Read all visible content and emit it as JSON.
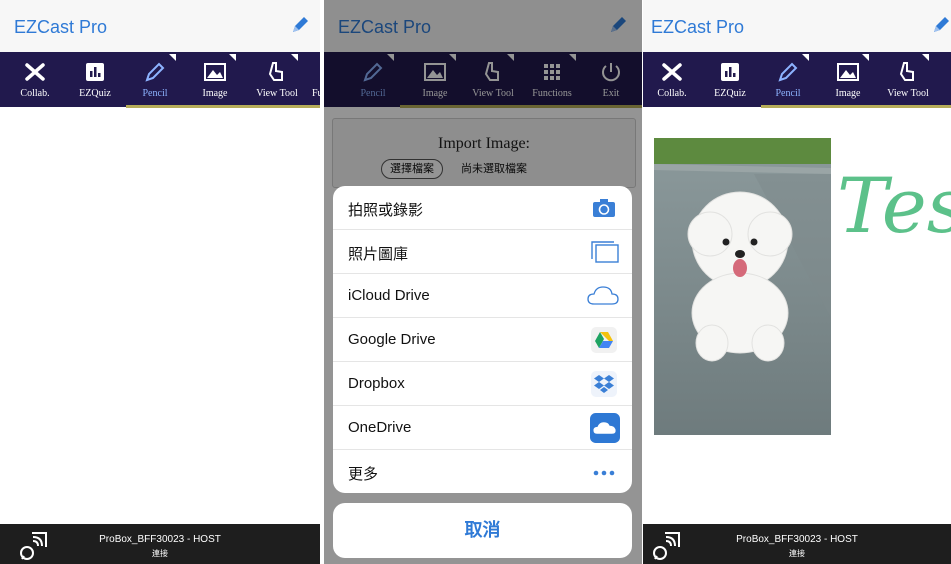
{
  "app_title": "EZCast Pro",
  "panel1": {
    "tools": [
      {
        "label": "Collab.",
        "icon": "collab-icon"
      },
      {
        "label": "EZQuiz",
        "icon": "ezquiz-icon"
      },
      {
        "label": "Pencil",
        "icon": "pencil-icon",
        "active": true
      },
      {
        "label": "Image",
        "icon": "image-icon"
      },
      {
        "label": "View Tool",
        "icon": "view-tool-icon"
      },
      {
        "label": "Fu",
        "icon": ""
      }
    ],
    "status": {
      "device": "ProBox_BFF30023 - HOST",
      "connection": "連接"
    }
  },
  "panel2": {
    "tools": [
      {
        "label": "Pencil",
        "icon": "pencil-icon",
        "active": true
      },
      {
        "label": "Image",
        "icon": "image-icon"
      },
      {
        "label": "View Tool",
        "icon": "view-tool-icon"
      },
      {
        "label": "Functions",
        "icon": "functions-icon"
      },
      {
        "label": "Exit",
        "icon": "exit-icon"
      }
    ],
    "import": {
      "title": "Import Image:",
      "choose_file": "選擇檔案",
      "no_file": "尚未選取檔案"
    },
    "sheet": [
      {
        "label": "拍照或錄影",
        "icon": "camera-icon"
      },
      {
        "label": "照片圖庫",
        "icon": "photo-library-icon"
      },
      {
        "label": "iCloud Drive",
        "icon": "icloud-icon"
      },
      {
        "label": "Google Drive",
        "icon": "google-drive-icon"
      },
      {
        "label": "Dropbox",
        "icon": "dropbox-icon"
      },
      {
        "label": "OneDrive",
        "icon": "onedrive-icon"
      },
      {
        "label": "更多",
        "icon": "more-icon"
      }
    ],
    "cancel": "取消"
  },
  "panel3": {
    "tools": [
      {
        "label": "Collab.",
        "icon": "collab-icon"
      },
      {
        "label": "EZQuiz",
        "icon": "ezquiz-icon"
      },
      {
        "label": "Pencil",
        "icon": "pencil-icon",
        "active": true
      },
      {
        "label": "Image",
        "icon": "image-icon"
      },
      {
        "label": "View Tool",
        "icon": "view-tool-icon"
      }
    ],
    "handwriting": "Test",
    "status": {
      "device": "ProBox_BFF30023 - HOST",
      "connection": "連接"
    }
  },
  "colors": {
    "accent": "#2f7ad6",
    "toolbar": "#21194d",
    "active_label": "#8db3ff",
    "underline": "#b6ac59",
    "ink": "#5cc18a"
  }
}
